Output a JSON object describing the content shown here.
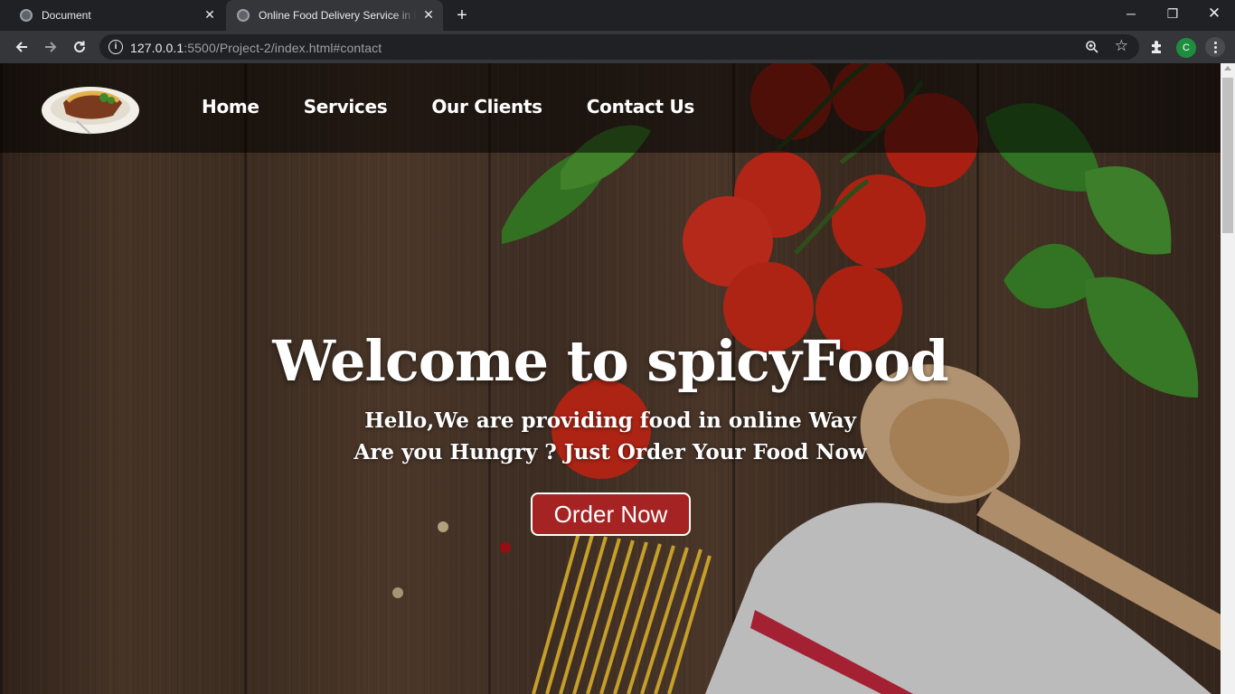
{
  "browser": {
    "tabs": [
      {
        "title": "Document",
        "active": false
      },
      {
        "title": "Online Food Delivery Service in In",
        "active": true
      }
    ],
    "url_host": "127.0.0.1",
    "url_rest": ":5500/Project-2/index.html#contact",
    "profile_initial": "C",
    "profile_color": "#1e8e3e"
  },
  "nav": {
    "links": [
      "Home",
      "Services",
      "Our Clients",
      "Contact Us"
    ]
  },
  "hero": {
    "heading": "Welcome to spicyFood",
    "line1": "Hello,We are providing food in online Way",
    "line2": "Are you Hungry ? Just Order Your Food Now",
    "button_label": "Order Now",
    "button_color": "#a52323"
  }
}
